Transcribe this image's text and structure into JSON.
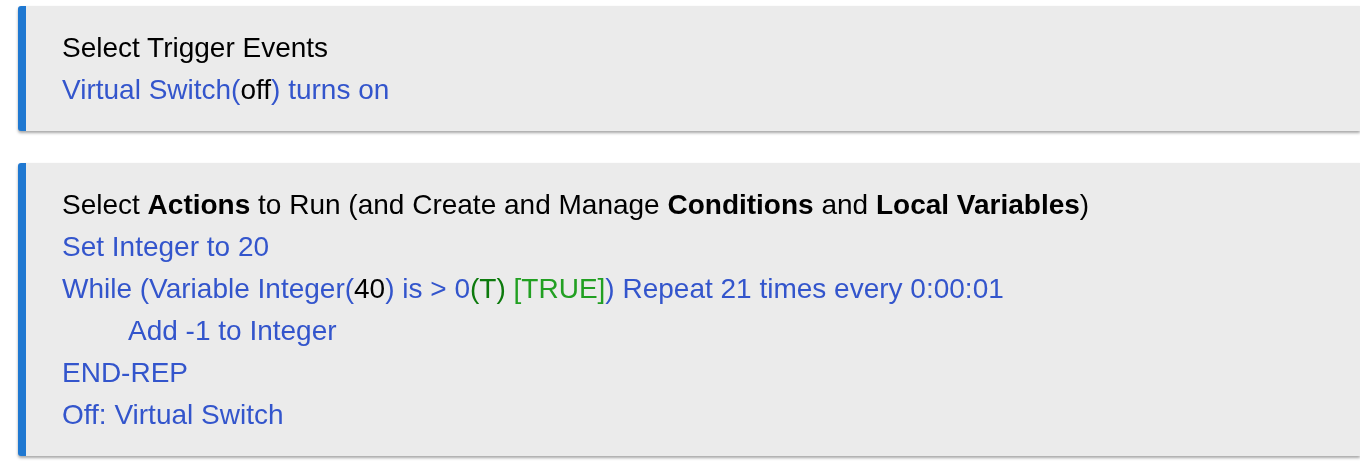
{
  "sections": [
    {
      "title": "Select Trigger Events",
      "lines": [
        {
          "segments": [
            {
              "text": "Virtual Switch(",
              "kind": "action"
            },
            {
              "text": "off",
              "kind": "value"
            },
            {
              "text": ") turns on",
              "kind": "action"
            }
          ]
        }
      ]
    },
    {
      "title": "Select **Actions** to Run (and Create and Manage **Conditions** and **Local Variables**)",
      "lines": [
        {
          "segments": [
            {
              "text": "Set Integer to 20",
              "kind": "action"
            }
          ]
        },
        {
          "segments": [
            {
              "text": "While (Variable Integer(",
              "kind": "action"
            },
            {
              "text": "40",
              "kind": "value"
            },
            {
              "text": ") is > 0",
              "kind": "action"
            },
            {
              "text": "(T)",
              "kind": "test"
            },
            {
              "text": " [TRUE]",
              "kind": "result"
            },
            {
              "text": ") Repeat 21 times every 0:00:01",
              "kind": "action"
            }
          ],
          "children": [
            {
              "segments": [
                {
                  "text": "Add -1 to Integer",
                  "kind": "action"
                }
              ]
            }
          ]
        },
        {
          "segments": [
            {
              "text": "END-REP",
              "kind": "action"
            }
          ]
        },
        {
          "segments": [
            {
              "text": "Off: Virtual Switch",
              "kind": "action"
            }
          ]
        }
      ]
    }
  ]
}
